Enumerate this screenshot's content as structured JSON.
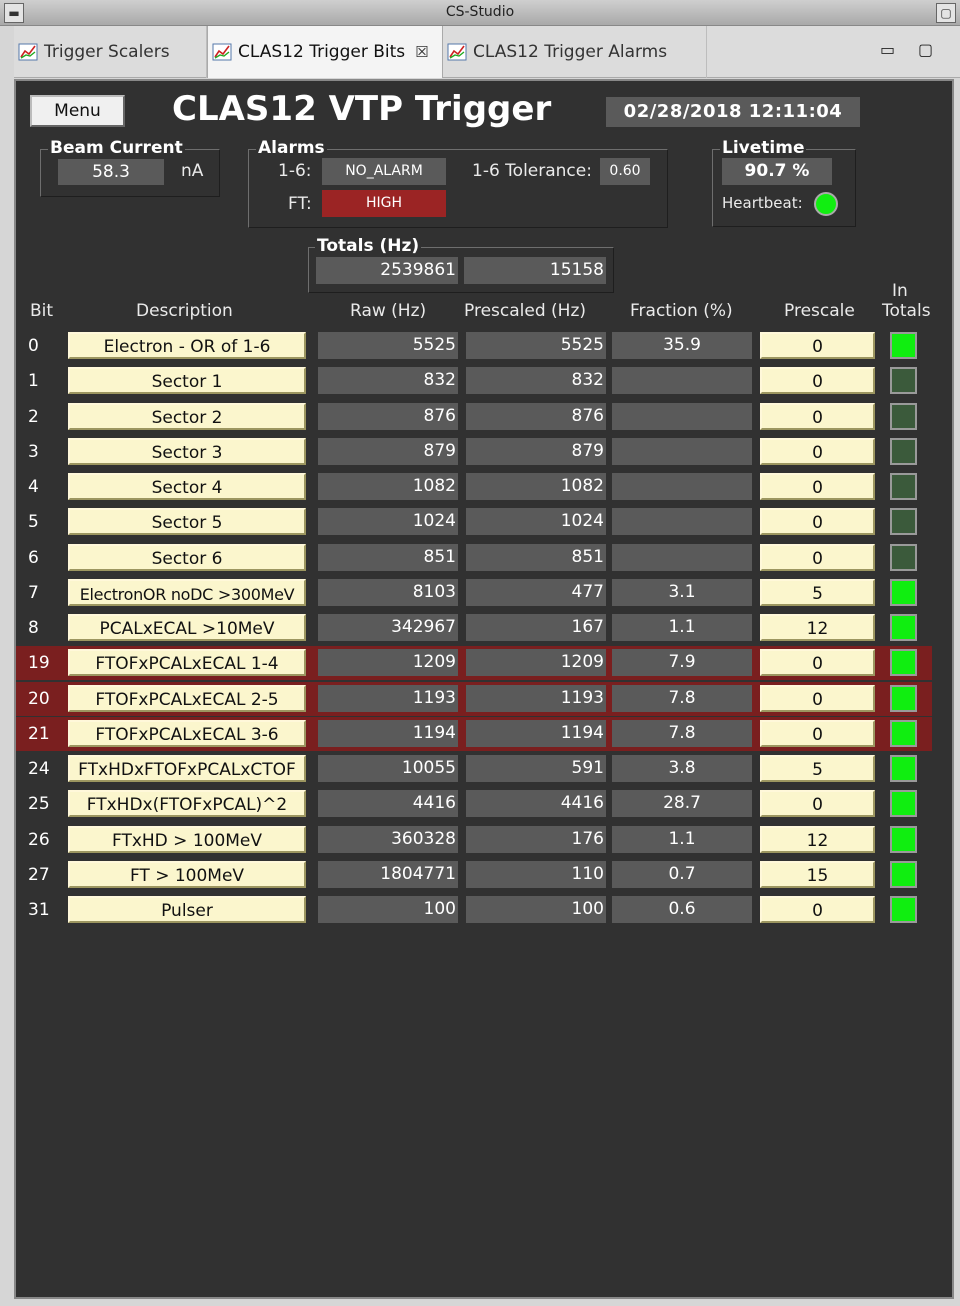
{
  "window": {
    "title": "CS-Studio"
  },
  "tabs": [
    {
      "label": "Trigger Scalers",
      "active": false
    },
    {
      "label": "CLAS12 Trigger Bits",
      "active": true
    },
    {
      "label": "CLAS12 Trigger Alarms",
      "active": false
    }
  ],
  "tab_close_glyph": "☒",
  "window_controls": {
    "minimize": "▭",
    "maximize": "▢"
  },
  "panel": {
    "menu_label": "Menu",
    "title": "CLAS12 VTP Trigger",
    "datetime": "02/28/2018 12:11:04"
  },
  "beam_current": {
    "label": "Beam Current",
    "value": "58.3",
    "unit": "nA"
  },
  "alarms": {
    "label": "Alarms",
    "sector_label": "1-6:",
    "sector_value": "NO_ALARM",
    "tolerance_label": "1-6 Tolerance:",
    "tolerance_value": "0.60",
    "ft_label": "FT:",
    "ft_value": "HIGH"
  },
  "livetime": {
    "label": "Livetime",
    "value": "90.7 %",
    "heartbeat_label": "Heartbeat:"
  },
  "totals": {
    "label": "Totals (Hz)",
    "raw": "2539861",
    "prescaled": "15158"
  },
  "columns": {
    "bit": "Bit",
    "description": "Description",
    "raw": "Raw (Hz)",
    "prescaled": "Prescaled (Hz)",
    "fraction": "Fraction (%)",
    "prescale": "Prescale",
    "in_totals_1": "In",
    "in_totals_2": "Totals"
  },
  "rows": [
    {
      "bit": "0",
      "desc": "Electron - OR of 1-6",
      "raw": "5525",
      "prescaled": "5525",
      "fraction": "35.9",
      "prescale": "0",
      "in_totals": true,
      "alarm": false
    },
    {
      "bit": "1",
      "desc": "Sector 1",
      "raw": "832",
      "prescaled": "832",
      "fraction": "",
      "prescale": "0",
      "in_totals": false,
      "alarm": false
    },
    {
      "bit": "2",
      "desc": "Sector 2",
      "raw": "876",
      "prescaled": "876",
      "fraction": "",
      "prescale": "0",
      "in_totals": false,
      "alarm": false
    },
    {
      "bit": "3",
      "desc": "Sector 3",
      "raw": "879",
      "prescaled": "879",
      "fraction": "",
      "prescale": "0",
      "in_totals": false,
      "alarm": false
    },
    {
      "bit": "4",
      "desc": "Sector 4",
      "raw": "1082",
      "prescaled": "1082",
      "fraction": "",
      "prescale": "0",
      "in_totals": false,
      "alarm": false
    },
    {
      "bit": "5",
      "desc": "Sector 5",
      "raw": "1024",
      "prescaled": "1024",
      "fraction": "",
      "prescale": "0",
      "in_totals": false,
      "alarm": false
    },
    {
      "bit": "6",
      "desc": "Sector 6",
      "raw": "851",
      "prescaled": "851",
      "fraction": "",
      "prescale": "0",
      "in_totals": false,
      "alarm": false
    },
    {
      "bit": "7",
      "desc": "ElectronOR noDC >300MeV",
      "raw": "8103",
      "prescaled": "477",
      "fraction": "3.1",
      "prescale": "5",
      "in_totals": true,
      "alarm": false
    },
    {
      "bit": "8",
      "desc": "PCALxECAL >10MeV",
      "raw": "342967",
      "prescaled": "167",
      "fraction": "1.1",
      "prescale": "12",
      "in_totals": true,
      "alarm": false
    },
    {
      "bit": "19",
      "desc": "FTOFxPCALxECAL 1-4",
      "raw": "1209",
      "prescaled": "1209",
      "fraction": "7.9",
      "prescale": "0",
      "in_totals": true,
      "alarm": true
    },
    {
      "bit": "20",
      "desc": "FTOFxPCALxECAL 2-5",
      "raw": "1193",
      "prescaled": "1193",
      "fraction": "7.8",
      "prescale": "0",
      "in_totals": true,
      "alarm": true
    },
    {
      "bit": "21",
      "desc": "FTOFxPCALxECAL 3-6",
      "raw": "1194",
      "prescaled": "1194",
      "fraction": "7.8",
      "prescale": "0",
      "in_totals": true,
      "alarm": true
    },
    {
      "bit": "24",
      "desc": "FTxHDxFTOFxPCALxCTOF",
      "raw": "10055",
      "prescaled": "591",
      "fraction": "3.8",
      "prescale": "5",
      "in_totals": true,
      "alarm": false
    },
    {
      "bit": "25",
      "desc": "FTxHDx(FTOFxPCAL)^2",
      "raw": "4416",
      "prescaled": "4416",
      "fraction": "28.7",
      "prescale": "0",
      "in_totals": true,
      "alarm": false
    },
    {
      "bit": "26",
      "desc": "FTxHD > 100MeV",
      "raw": "360328",
      "prescaled": "176",
      "fraction": "1.1",
      "prescale": "12",
      "in_totals": true,
      "alarm": false
    },
    {
      "bit": "27",
      "desc": "FT > 100MeV",
      "raw": "1804771",
      "prescaled": "110",
      "fraction": "0.7",
      "prescale": "15",
      "in_totals": true,
      "alarm": false
    },
    {
      "bit": "31",
      "desc": "Pulser",
      "raw": "100",
      "prescaled": "100",
      "fraction": "0.6",
      "prescale": "0",
      "in_totals": true,
      "alarm": false
    }
  ],
  "colors": {
    "panel_bg": "#313131",
    "field_bg": "#5a5a5a",
    "input_bg": "#fbf6cd",
    "alarm_row": "#7a1f1f",
    "alarm_high": "#9b2424",
    "led_on": "#10ee10",
    "led_off": "#3b5a3b"
  }
}
